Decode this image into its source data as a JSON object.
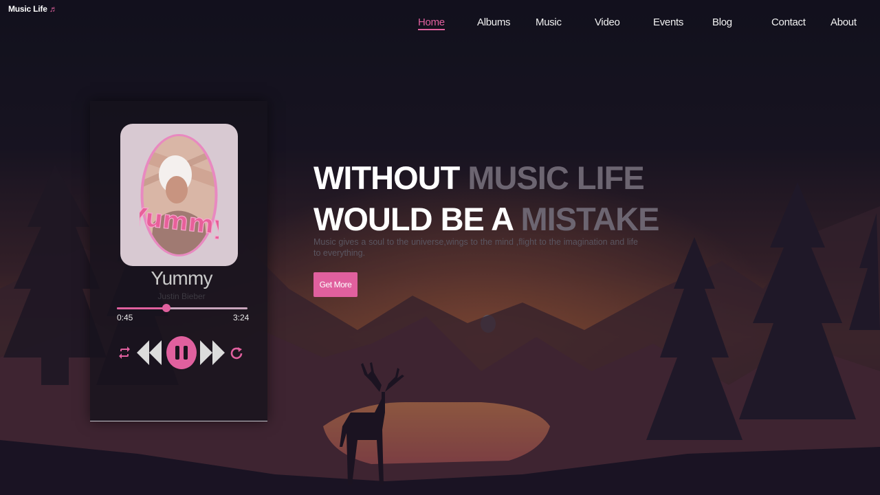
{
  "brand": {
    "name": "Music Life",
    "icon": "music-note-icon"
  },
  "nav": [
    {
      "label": "Home",
      "active": true
    },
    {
      "label": "Albums",
      "active": false
    },
    {
      "label": "Music",
      "active": false
    },
    {
      "label": "Video",
      "active": false
    },
    {
      "label": "Events",
      "active": false
    },
    {
      "label": "Blog",
      "active": false
    },
    {
      "label": "Contact",
      "active": false
    },
    {
      "label": "About",
      "active": false
    }
  ],
  "player": {
    "song": "Yummy",
    "artist": "Justin Bieber",
    "current_time": "0:45",
    "total_time": "3:24",
    "progress": 0.38,
    "cover_lettering": "Yummy",
    "controls": [
      "repeat-icon",
      "previous-icon",
      "pause-icon",
      "next-icon",
      "refresh-icon"
    ]
  },
  "hero": {
    "line1_white": "WITHOUT",
    "line1_gray": "MUSIC LIFE",
    "line2_white": "WOULD BE A",
    "line2_gray": "MISTAKE",
    "subtitle": "Music gives a soul to the universe,wings to the mind ,flight to the imagination and life to everything.",
    "cta_label": "Get More"
  },
  "colors": {
    "accent": "#e0609e",
    "background": "#15121e"
  }
}
